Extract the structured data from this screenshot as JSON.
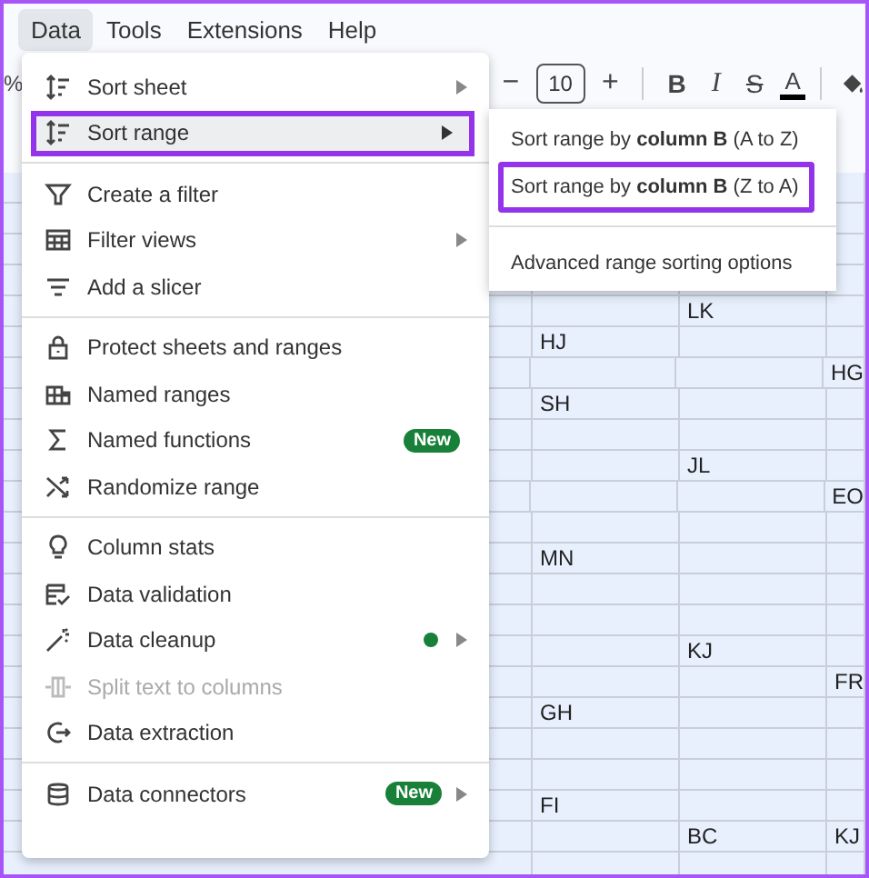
{
  "menubar": [
    {
      "label": "Data",
      "selected": true
    },
    {
      "label": "Tools",
      "selected": false
    },
    {
      "label": "Extensions",
      "selected": false
    },
    {
      "label": "Help",
      "selected": false
    }
  ],
  "toolbar": {
    "zoom": "%",
    "font_size": "10",
    "minus": "−",
    "plus": "+",
    "bold": "B",
    "italic": "I",
    "strike": "S",
    "text_color_letter": "A"
  },
  "menu": [
    {
      "kind": "item",
      "label": "Sort sheet",
      "submenu": true,
      "disabled": false,
      "highlighted": false
    },
    {
      "kind": "item",
      "label": "Sort range",
      "submenu": true,
      "disabled": false,
      "highlighted": true
    },
    {
      "kind": "divider"
    },
    {
      "kind": "item",
      "label": "Create a filter",
      "submenu": false,
      "disabled": false,
      "highlighted": false
    },
    {
      "kind": "item",
      "label": "Filter views",
      "submenu": true,
      "disabled": false,
      "highlighted": false
    },
    {
      "kind": "item",
      "label": "Add a slicer",
      "submenu": false,
      "disabled": false,
      "highlighted": false
    },
    {
      "kind": "divider"
    },
    {
      "kind": "item",
      "label": "Protect sheets and ranges",
      "submenu": false,
      "disabled": false,
      "highlighted": false
    },
    {
      "kind": "item",
      "label": "Named ranges",
      "submenu": false,
      "disabled": false,
      "highlighted": false
    },
    {
      "kind": "item",
      "label": "Named functions",
      "submenu": false,
      "disabled": false,
      "highlighted": false,
      "badge": "New"
    },
    {
      "kind": "item",
      "label": "Randomize range",
      "submenu": false,
      "disabled": false,
      "highlighted": false
    },
    {
      "kind": "divider"
    },
    {
      "kind": "item",
      "label": "Column stats",
      "submenu": false,
      "disabled": false,
      "highlighted": false
    },
    {
      "kind": "item",
      "label": "Data validation",
      "submenu": false,
      "disabled": false,
      "highlighted": false
    },
    {
      "kind": "item",
      "label": "Data cleanup",
      "submenu": true,
      "disabled": false,
      "highlighted": false,
      "new_dot": true
    },
    {
      "kind": "item",
      "label": "Split text to columns",
      "submenu": false,
      "disabled": true,
      "highlighted": false
    },
    {
      "kind": "item",
      "label": "Data extraction",
      "submenu": false,
      "disabled": false,
      "highlighted": false
    },
    {
      "kind": "divider"
    },
    {
      "kind": "item",
      "label": "Data connectors",
      "submenu": true,
      "disabled": false,
      "highlighted": false,
      "badge": "New"
    }
  ],
  "submenu": [
    {
      "kind": "item",
      "label": "Sort range by **column B** (A to Z)",
      "highlighted": false
    },
    {
      "kind": "item",
      "label": "Sort range by **column B** (Z to A)",
      "highlighted": true
    },
    {
      "kind": "divider"
    },
    {
      "kind": "item",
      "label": "Advanced range sorting options",
      "highlighted": false
    }
  ],
  "sheet_rows": [
    {
      "b": "",
      "c": "LK",
      "d": ""
    },
    {
      "b": "HJ",
      "c": "",
      "d": ""
    },
    {
      "b": "",
      "c": "",
      "d": "HG"
    },
    {
      "b": "SH",
      "c": "",
      "d": ""
    },
    {
      "b": "",
      "c": "",
      "d": ""
    },
    {
      "b": "",
      "c": "JL",
      "d": ""
    },
    {
      "b": "",
      "c": "",
      "d": "EO"
    },
    {
      "b": "",
      "c": "",
      "d": ""
    },
    {
      "b": "MN",
      "c": "",
      "d": ""
    },
    {
      "b": "",
      "c": "",
      "d": ""
    },
    {
      "b": "",
      "c": "",
      "d": ""
    },
    {
      "b": "",
      "c": "KJ",
      "d": ""
    },
    {
      "b": "",
      "c": "",
      "d": "FR"
    },
    {
      "b": "GH",
      "c": "",
      "d": ""
    },
    {
      "b": "",
      "c": "",
      "d": ""
    },
    {
      "b": "",
      "c": "",
      "d": ""
    },
    {
      "b": "FI",
      "c": "",
      "d": ""
    },
    {
      "b": "",
      "c": "BC",
      "d": "KJ"
    },
    {
      "b": "",
      "c": "",
      "d": ""
    }
  ]
}
